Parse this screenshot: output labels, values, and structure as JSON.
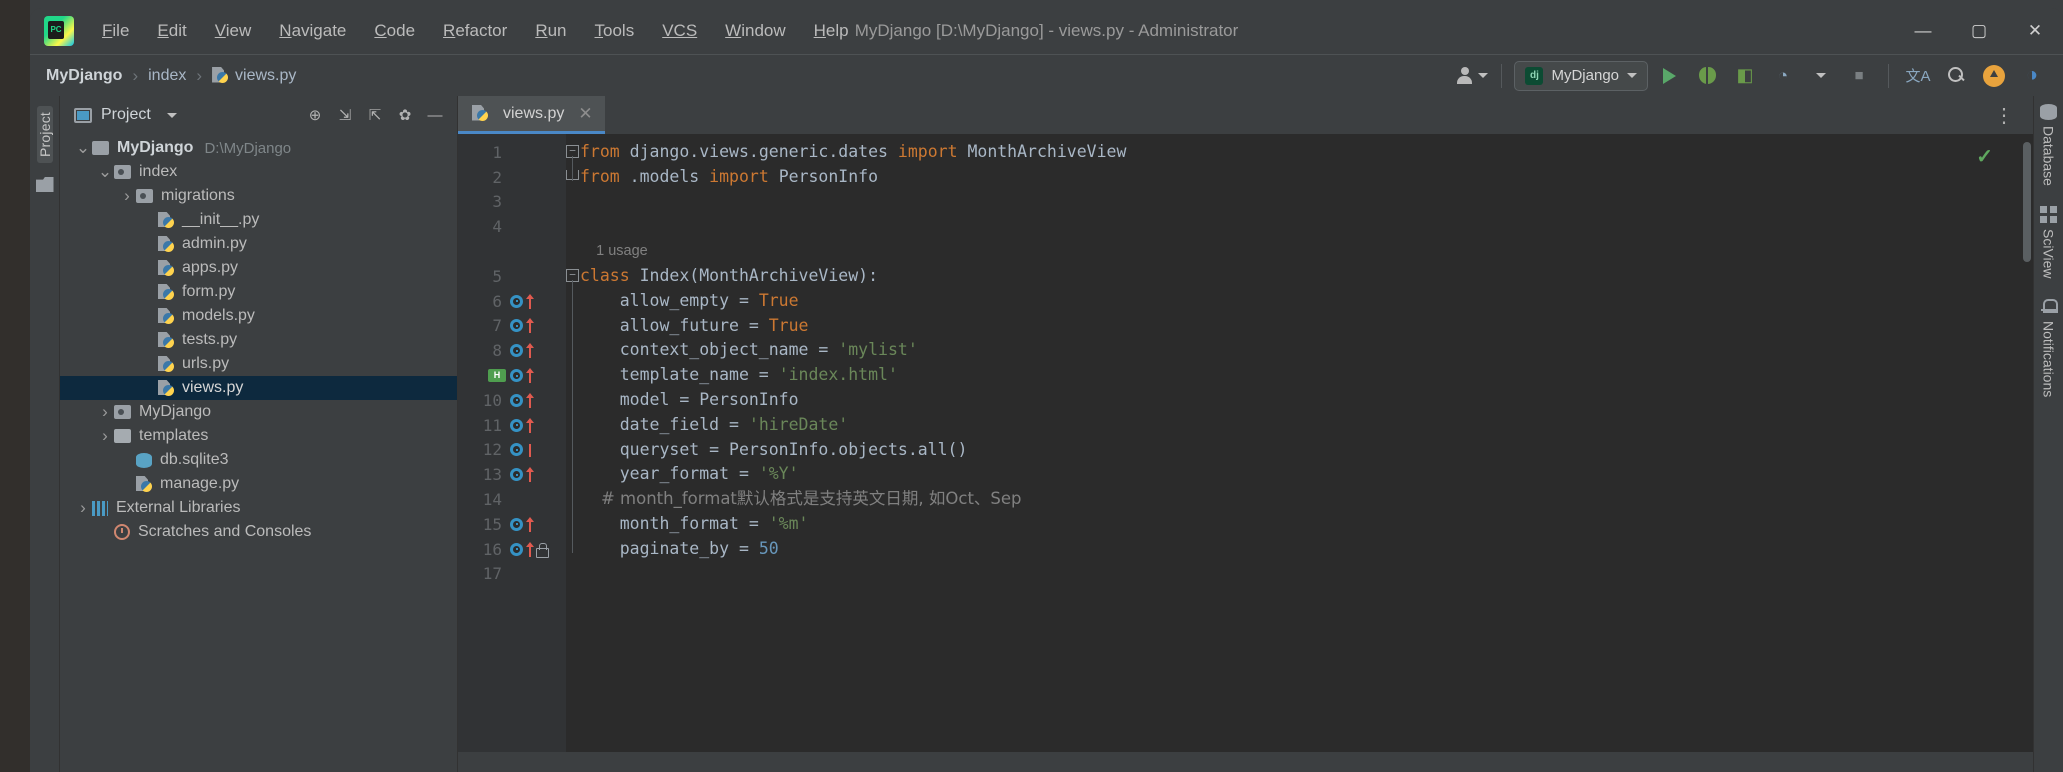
{
  "window": {
    "title": "MyDjango [D:\\MyDjango] - views.py - Administrator",
    "minimize": "—",
    "maximize": "▢",
    "close": "✕",
    "logo_text": "PC"
  },
  "menubar": {
    "items": [
      {
        "mnemonic": "F",
        "rest": "ile"
      },
      {
        "mnemonic": "E",
        "rest": "dit"
      },
      {
        "mnemonic": "V",
        "rest": "iew"
      },
      {
        "mnemonic": "N",
        "rest": "avigate"
      },
      {
        "mnemonic": "C",
        "rest": "ode"
      },
      {
        "mnemonic": "R",
        "rest": "efactor"
      },
      {
        "mnemonic": "R",
        "rest": "un"
      },
      {
        "mnemonic": "T",
        "rest": "ools"
      },
      {
        "mnemonic": "VCS",
        "rest": ""
      },
      {
        "mnemonic": "W",
        "rest": "indow"
      },
      {
        "mnemonic": "H",
        "rest": "elp"
      }
    ]
  },
  "breadcrumb": {
    "root": "MyDjango",
    "sep": "›",
    "middle": "index",
    "file": "views.py"
  },
  "navbar_right": {
    "account_icon": "person-icon",
    "run_config": {
      "badge": "dj",
      "label": "MyDjango"
    },
    "run_label": "Run",
    "debug_label": "Debug",
    "coverage_label": "Run with Coverage",
    "profile_label": "Profile",
    "stop_label": "Stop",
    "translate_label": "文A",
    "search_label": "Search Everywhere",
    "update_label": "Update Project",
    "ide_label": "IDE and Project Settings"
  },
  "left_rail": {
    "label": "Project",
    "structure_icon": "folder-icon"
  },
  "project_panel": {
    "title": "Project",
    "dropdown": "▾",
    "toolbar": [
      {
        "name": "select-opened-file-icon",
        "glyph": "⊕"
      },
      {
        "name": "expand-all-icon",
        "glyph": "⇲"
      },
      {
        "name": "collapse-all-icon",
        "glyph": "⇱"
      },
      {
        "name": "settings-gear-icon",
        "glyph": "✿"
      },
      {
        "name": "hide-panel-icon",
        "glyph": "—"
      }
    ],
    "tree": [
      {
        "label": "MyDjango",
        "sub": "D:\\MyDjango",
        "icon": "folder",
        "arrow": "v",
        "indent": 0,
        "bold": true,
        "selected": false
      },
      {
        "label": "index",
        "sub": "",
        "icon": "module-folder",
        "arrow": "v",
        "indent": 1,
        "bold": false,
        "selected": false
      },
      {
        "label": "migrations",
        "sub": "",
        "icon": "module-folder",
        "arrow": ">",
        "indent": 2,
        "bold": false,
        "selected": false
      },
      {
        "label": "__init__.py",
        "sub": "",
        "icon": "python",
        "arrow": "",
        "indent": 3,
        "bold": false,
        "selected": false
      },
      {
        "label": "admin.py",
        "sub": "",
        "icon": "python",
        "arrow": "",
        "indent": 3,
        "bold": false,
        "selected": false
      },
      {
        "label": "apps.py",
        "sub": "",
        "icon": "python",
        "arrow": "",
        "indent": 3,
        "bold": false,
        "selected": false
      },
      {
        "label": "form.py",
        "sub": "",
        "icon": "python",
        "arrow": "",
        "indent": 3,
        "bold": false,
        "selected": false
      },
      {
        "label": "models.py",
        "sub": "",
        "icon": "python",
        "arrow": "",
        "indent": 3,
        "bold": false,
        "selected": false
      },
      {
        "label": "tests.py",
        "sub": "",
        "icon": "python",
        "arrow": "",
        "indent": 3,
        "bold": false,
        "selected": false
      },
      {
        "label": "urls.py",
        "sub": "",
        "icon": "python",
        "arrow": "",
        "indent": 3,
        "bold": false,
        "selected": false
      },
      {
        "label": "views.py",
        "sub": "",
        "icon": "python",
        "arrow": "",
        "indent": 3,
        "bold": false,
        "selected": true
      },
      {
        "label": "MyDjango",
        "sub": "",
        "icon": "module-folder",
        "arrow": ">",
        "indent": 1,
        "bold": false,
        "selected": false
      },
      {
        "label": "templates",
        "sub": "",
        "icon": "plain-folder",
        "arrow": ">",
        "indent": 1,
        "bold": false,
        "selected": false
      },
      {
        "label": "db.sqlite3",
        "sub": "",
        "icon": "database",
        "arrow": "",
        "indent": 2,
        "bold": false,
        "selected": false
      },
      {
        "label": "manage.py",
        "sub": "",
        "icon": "python",
        "arrow": "",
        "indent": 2,
        "bold": false,
        "selected": false
      },
      {
        "label": "External Libraries",
        "sub": "",
        "icon": "library",
        "arrow": ">",
        "indent": 0,
        "bold": false,
        "selected": false
      },
      {
        "label": "Scratches and Consoles",
        "sub": "",
        "icon": "scratch",
        "arrow": "",
        "indent": 1,
        "bold": false,
        "selected": false
      }
    ]
  },
  "editor": {
    "tab": {
      "label": "views.py",
      "close": "✕"
    },
    "options_icon": "⋮",
    "inspection_ok": "✓",
    "lines": [
      {
        "num": "1",
        "fold": "minus",
        "gutter": "",
        "type": "code",
        "tokens": [
          {
            "t": "from",
            "c": "kw"
          },
          {
            "t": " django.views.generic.dates ",
            "c": "id"
          },
          {
            "t": "import",
            "c": "kw"
          },
          {
            "t": " MonthArchiveView",
            "c": "id"
          }
        ]
      },
      {
        "num": "2",
        "fold": "end",
        "gutter": "",
        "type": "code",
        "tokens": [
          {
            "t": "from",
            "c": "kw"
          },
          {
            "t": " .models ",
            "c": "id"
          },
          {
            "t": "import",
            "c": "kw"
          },
          {
            "t": " PersonInfo",
            "c": "id"
          }
        ]
      },
      {
        "num": "3",
        "fold": "",
        "gutter": "",
        "type": "code",
        "tokens": []
      },
      {
        "num": "4",
        "fold": "",
        "gutter": "",
        "type": "code",
        "tokens": []
      },
      {
        "num": "",
        "fold": "",
        "gutter": "",
        "type": "inlay",
        "text": "1 usage"
      },
      {
        "num": "5",
        "fold": "minus",
        "gutter": "",
        "type": "code",
        "tokens": [
          {
            "t": "class",
            "c": "kw"
          },
          {
            "t": " Index(MonthArchiveView):",
            "c": "id"
          }
        ]
      },
      {
        "num": "6",
        "fold": "",
        "gutter": "override",
        "type": "code",
        "tokens": [
          {
            "t": "    allow_empty = ",
            "c": "id"
          },
          {
            "t": "True",
            "c": "kw"
          }
        ]
      },
      {
        "num": "7",
        "fold": "",
        "gutter": "override",
        "type": "code",
        "tokens": [
          {
            "t": "    allow_future = ",
            "c": "id"
          },
          {
            "t": "True",
            "c": "kw"
          }
        ]
      },
      {
        "num": "8",
        "fold": "",
        "gutter": "override",
        "type": "code",
        "tokens": [
          {
            "t": "    context_object_name = ",
            "c": "id"
          },
          {
            "t": "'mylist'",
            "c": "str"
          }
        ]
      },
      {
        "num": "9",
        "fold": "",
        "gutter": "override-html",
        "type": "code",
        "tokens": [
          {
            "t": "    template_name = ",
            "c": "id"
          },
          {
            "t": "'index.html'",
            "c": "str"
          }
        ]
      },
      {
        "num": "10",
        "fold": "",
        "gutter": "override",
        "type": "code",
        "tokens": [
          {
            "t": "    model = PersonInfo",
            "c": "id"
          }
        ]
      },
      {
        "num": "11",
        "fold": "",
        "gutter": "override",
        "type": "code",
        "tokens": [
          {
            "t": "    date_field = ",
            "c": "id"
          },
          {
            "t": "'hireDate'",
            "c": "str"
          }
        ]
      },
      {
        "num": "12",
        "fold": "",
        "gutter": "override-stub",
        "type": "code",
        "tokens": [
          {
            "t": "    queryset = PersonInfo.objects.all()",
            "c": "id"
          }
        ]
      },
      {
        "num": "13",
        "fold": "",
        "gutter": "override",
        "type": "code",
        "tokens": [
          {
            "t": "    year_format = ",
            "c": "id"
          },
          {
            "t": "'%Y'",
            "c": "str"
          }
        ]
      },
      {
        "num": "14",
        "fold": "",
        "gutter": "",
        "type": "code",
        "tokens": [
          {
            "t": "    # month_format默认格式是支持英文日期, 如Oct、Sep",
            "c": "cmt"
          }
        ]
      },
      {
        "num": "15",
        "fold": "",
        "gutter": "override",
        "type": "code",
        "tokens": [
          {
            "t": "    month_format = ",
            "c": "id"
          },
          {
            "t": "'%m'",
            "c": "str"
          }
        ]
      },
      {
        "num": "16",
        "fold": "",
        "gutter": "override-lock",
        "type": "code",
        "tokens": [
          {
            "t": "    paginate_by = ",
            "c": "id"
          },
          {
            "t": "50",
            "c": "num"
          }
        ]
      },
      {
        "num": "17",
        "fold": "",
        "gutter": "",
        "type": "code",
        "tokens": []
      }
    ]
  },
  "right_rail": {
    "items": [
      {
        "label": "Database",
        "icon": "database-icon"
      },
      {
        "label": "SciView",
        "icon": "grid-icon"
      },
      {
        "label": "Notifications",
        "icon": "bell-icon"
      }
    ]
  }
}
